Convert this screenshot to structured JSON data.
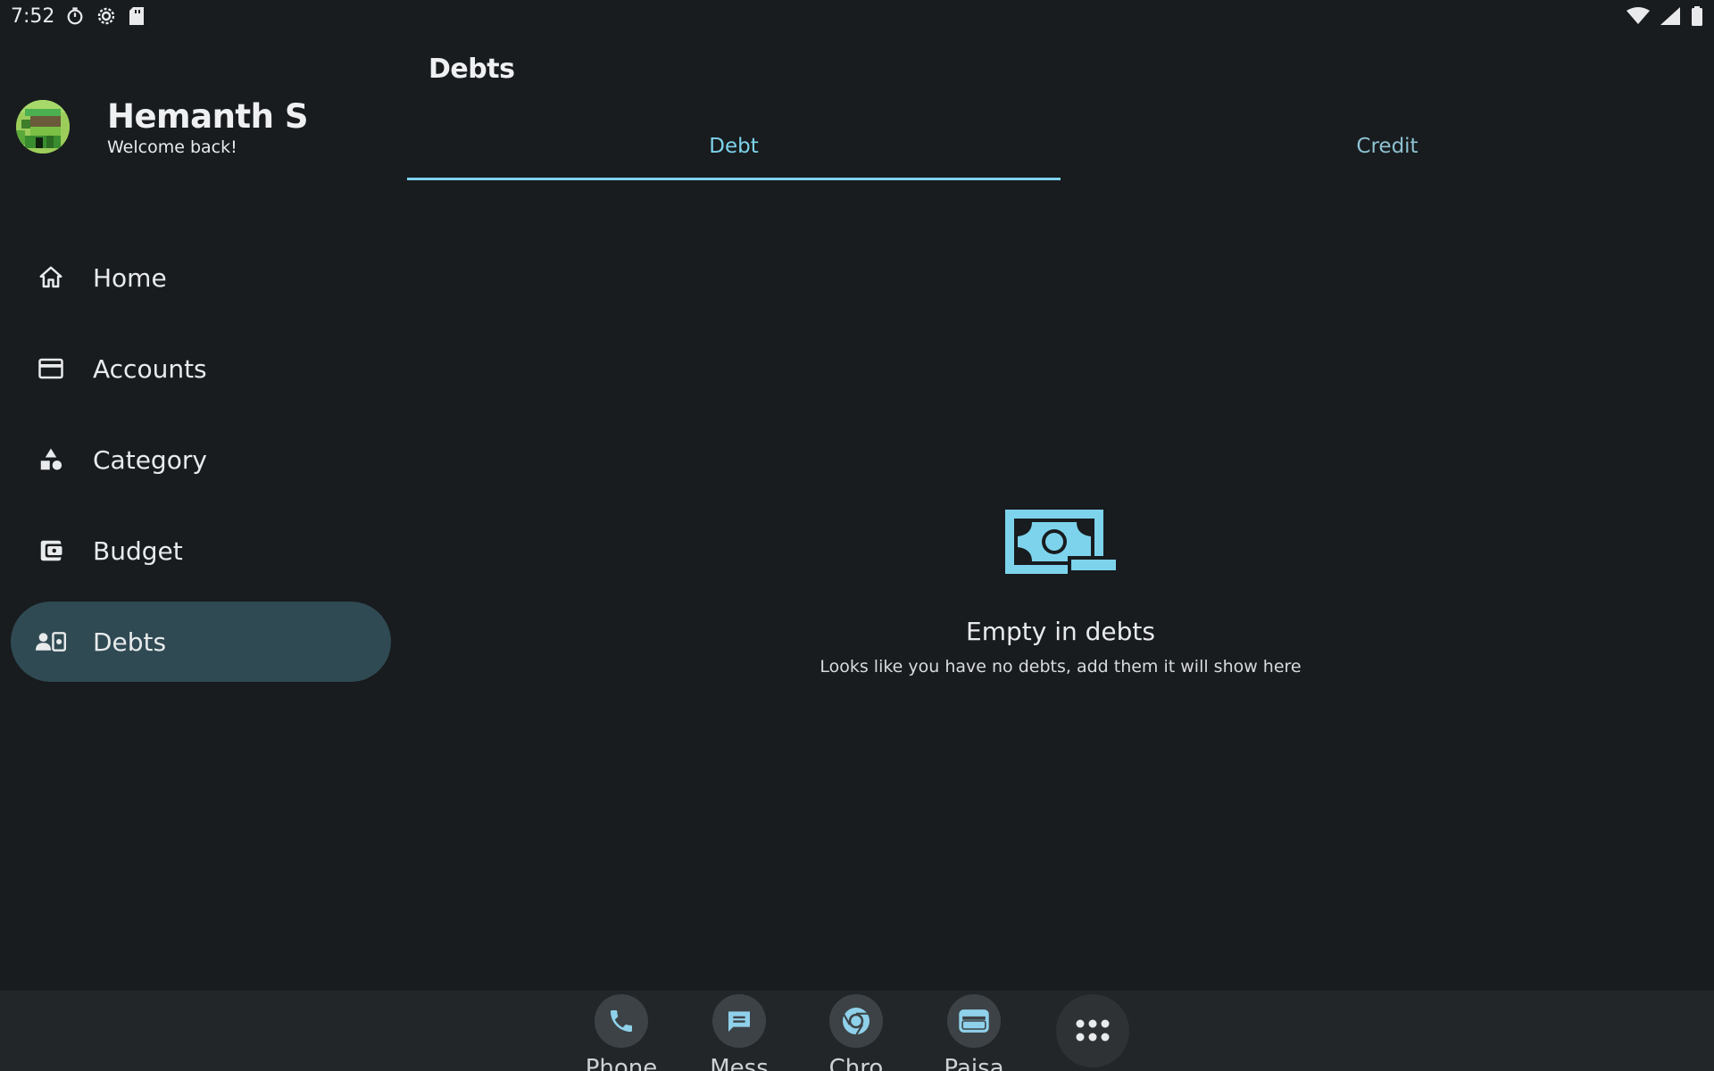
{
  "status_bar": {
    "time": "7:52"
  },
  "profile": {
    "name": "Hemanth S",
    "subtitle": "Welcome back!"
  },
  "nav": {
    "items": [
      {
        "label": "Home",
        "icon": "home-icon",
        "active": false
      },
      {
        "label": "Accounts",
        "icon": "credit-card-icon",
        "active": false
      },
      {
        "label": "Category",
        "icon": "shapes-icon",
        "active": false
      },
      {
        "label": "Budget",
        "icon": "wallet-icon",
        "active": false
      },
      {
        "label": "Debts",
        "icon": "person-debt-icon",
        "active": true
      }
    ]
  },
  "main": {
    "title": "Debts",
    "tabs": [
      {
        "label": "Debt",
        "selected": true
      },
      {
        "label": "Credit",
        "selected": false
      }
    ],
    "empty_state": {
      "icon": "money-bill-icon",
      "title": "Empty in debts",
      "subtitle": "Looks like you have no debts, add them it will show here"
    }
  },
  "dock": {
    "apps": [
      {
        "label": "Phone",
        "icon": "phone-icon"
      },
      {
        "label": "Mess",
        "icon": "messages-icon"
      },
      {
        "label": "Chro",
        "icon": "chrome-icon"
      },
      {
        "label": "Paisa",
        "icon": "paisa-icon"
      }
    ],
    "all_apps_icon": "app-drawer-icon"
  },
  "colors": {
    "background": "#191c1e",
    "accent": "#7ed3ec",
    "active_nav": "#2f4a52"
  }
}
